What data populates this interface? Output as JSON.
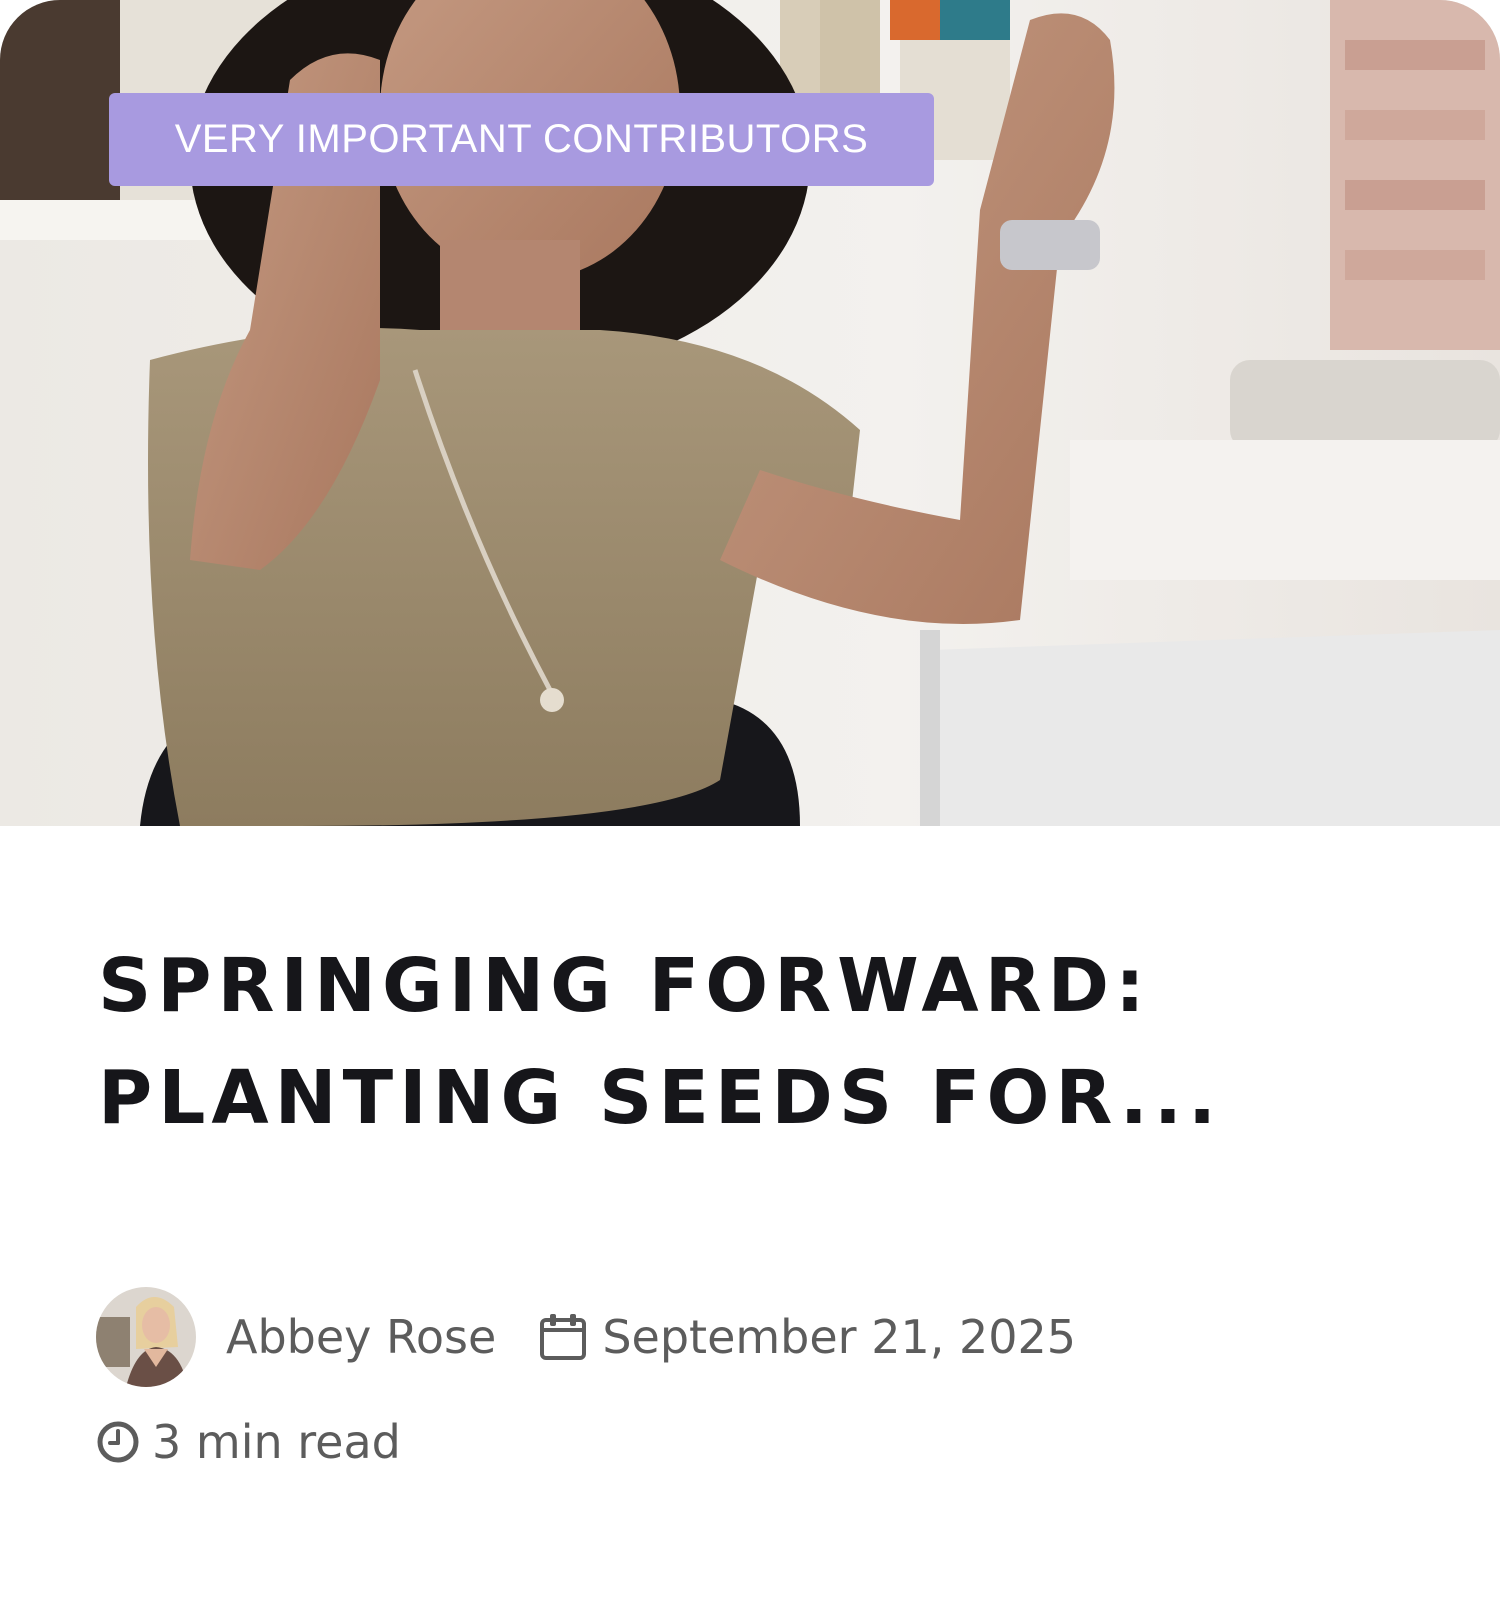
{
  "post": {
    "category": "VERY IMPORTANT CONTRIBUTORS",
    "title": "SPRINGING FORWARD: PLANTING SEEDS FOR...",
    "author": "Abbey Rose",
    "date": "September 21, 2025",
    "read_time": "3 min read"
  },
  "icons": {
    "date": "calendar-icon",
    "read_time": "clock-icon"
  },
  "colors": {
    "badge_background": "#a89ae0",
    "title_text": "#16161a",
    "meta_text": "#5c5c5c"
  }
}
